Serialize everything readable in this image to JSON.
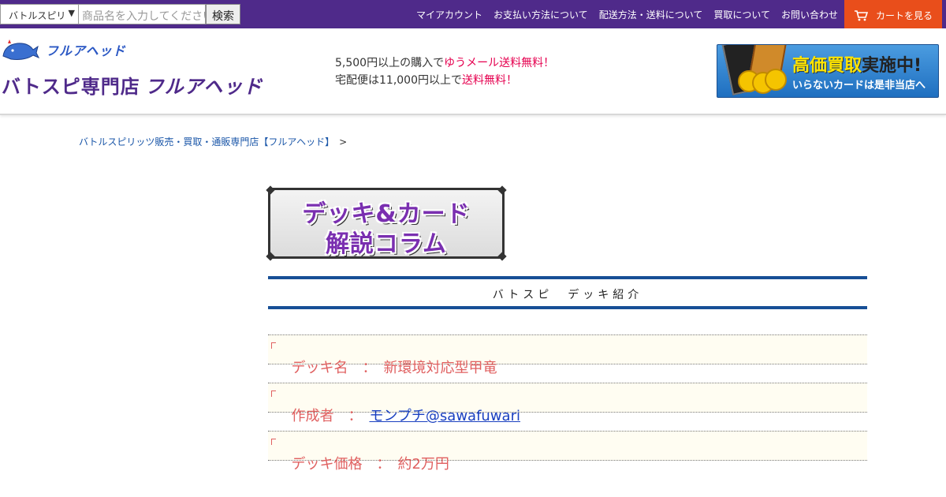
{
  "topbar": {
    "category_select": "バトルスピリ",
    "search_placeholder": "商品名を入力してください",
    "search_button": "検索",
    "nav": [
      "マイアカウント",
      "お支払い方法について",
      "配送方法・送料について",
      "買取について",
      "お問い合わせ"
    ],
    "cart_label": "カートを見る"
  },
  "header": {
    "brand_small": "フルアヘッド",
    "logo_prefix": "バトスピ専門店",
    "logo_brand": "フルアヘッド",
    "shipping_line1_pre": "5,500円以上の購入で",
    "shipping_line1_hl": "ゆうメール送料無料！",
    "shipping_line2_pre": "宅配便は11,000円以上で",
    "shipping_line2_hl": "送料無料！",
    "buyback_title_a": "高価買取",
    "buyback_title_b": "実施中!",
    "buyback_sub": "いらないカードは是非当店へ"
  },
  "breadcrumb": {
    "link": "バトルスピリッツ販売・買取・通販専門店【フルアヘッド】",
    "sep": ">"
  },
  "column_banner": {
    "line1": "デッキ&カード",
    "line2": "解説コラム"
  },
  "section": {
    "heading": "バトスピ　デッキ紹介"
  },
  "info": {
    "deck_name_label": "デッキ名　：　",
    "deck_name_value": "新環境対応型甲竜",
    "author_label": "作成者　：　",
    "author_value": "モンプチ@sawafuwari",
    "price_label": "デッキ価格　：　",
    "price_value": "約2万円"
  },
  "colors": {
    "topbar": "#4f2a8a",
    "cart": "#e94e1b",
    "heading_border": "#174f96",
    "info_text": "#e06060",
    "highlight": "#e5004f"
  }
}
